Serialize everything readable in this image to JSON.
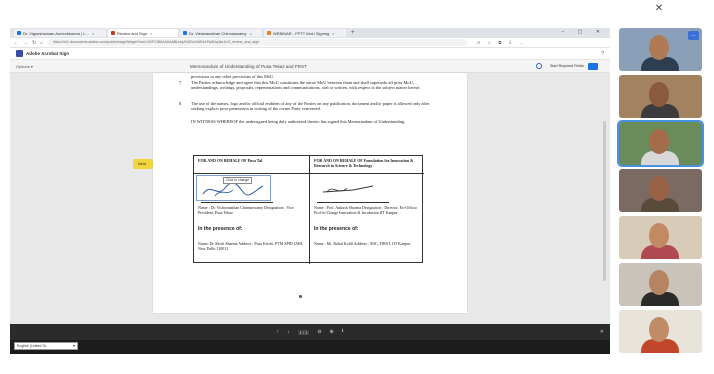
{
  "browser": {
    "tabs": [
      {
        "label": "Dr. Vigneshwaran Aneeshkumar | L...",
        "color": "#1a73e8",
        "active": false
      },
      {
        "label": "Review and Sign",
        "color": "#c0392b",
        "active": true
      },
      {
        "label": "Dr. Vishwanathan Chinnaswamy",
        "color": "#1a73e8",
        "active": false
      },
      {
        "label": "WEBINAR - FPTT MoU Signing",
        "color": "#e67e22",
        "active": false
      }
    ],
    "window_controls": "–  ▢  ✕",
    "url": "https://in1.documents.adobe.com/public/esignWidget?wid=CBFCIBAA3AAABLblqZhBZu2vM2e1Pp6Nq4kx1nO_review_and_sign",
    "toolbar_icons": [
      "A",
      "☆",
      "⧉",
      "⇩",
      "…"
    ]
  },
  "acrobat": {
    "name": "Adobe Acrobat Sign",
    "help_icon": "?"
  },
  "doc_toolbar": {
    "options": "Options ▾",
    "title": "Memorandum of Understanding of Pusa Tekaz and FRST",
    "start_signing": "Start Required Fields"
  },
  "document": {
    "para_top": "provisions in any other provisions of this MoU.",
    "clause_7_num": "7.",
    "clause_7": "The Parties acknowledge and agree that this MoU constitutes the entire MoU between them and shall supersede all prior MoU, understandings, writings, proposals, representations and communications, oral or written, with respect to the subject matter hereof.",
    "clause_8_num": "8.",
    "clause_8": "The use of the names, logo and/or official emblem of any of the Parties on any publication, document and/or paper is allowed only after seeking explicit prior permission in writing of the owner Party concerned.",
    "witness_line": "IN WITNESS WHEREOF the undersigned being duly authorized thereto has signed this Memorandum of Understanding.",
    "left_head": "FOR AND ON BEHALF OF Pusa Tal.",
    "right_head": "FOR AND ON BEHALF OF Foundation for Innovation & Research in Science & Technology",
    "click_to_change": "Click to change",
    "left_meta": "Name : Dr. Vishwanathan Chinnaswamy Designation : Vice President, Pusa Tekaz",
    "right_meta": "Name : Prof. Ankush Sharma Designation : Director, Ex-Officio Prof-in-Charge Innovation & Incubation IIT Kanpur",
    "presence_left": "In the presence of:",
    "presence_right": "In the presence of:",
    "left_witness": "Name: Dr Akriti Sharma  Address : Pusa Krishi, PTM SPID IARI, New Delhi 110012",
    "right_witness": "Name : Mr. Rahul Kohli  Address : SIIC, FIRST, IIT Kanpur",
    "next_tag": "Next"
  },
  "share_controls": {
    "up": "↑",
    "down": "↓",
    "page": "1 / 1",
    "zoom_out": "⊖",
    "zoom_in": "⊕",
    "download": "⭳",
    "close": "✕"
  },
  "language_select": {
    "value": "English (United St..."
  },
  "top_close": "✕",
  "participants": {
    "tiles": [
      {
        "bg": "#8a9fb8",
        "skin": "#b07a55",
        "shirt": "#2c3e50",
        "active": false,
        "badge": "…"
      },
      {
        "bg": "#a3835f",
        "skin": "#8a5a3c",
        "shirt": "#3c3c3c",
        "active": false,
        "badge": ""
      },
      {
        "bg": "#6a8c5a",
        "skin": "#a46c4b",
        "shirt": "#d8d8d8",
        "active": true,
        "badge": ""
      },
      {
        "bg": "#7a6a62",
        "skin": "#9a6245",
        "shirt": "#5a4a3a",
        "active": false,
        "badge": ""
      },
      {
        "bg": "#d8cbb8",
        "skin": "#c28a64",
        "shirt": "#b14b52",
        "active": false,
        "badge": ""
      },
      {
        "bg": "#c9c3b9",
        "skin": "#b78461",
        "shirt": "#2a2a2a",
        "active": false,
        "badge": ""
      },
      {
        "bg": "#e9e4da",
        "skin": "#c08c67",
        "shirt": "#c2462c",
        "active": false,
        "badge": ""
      }
    ]
  }
}
